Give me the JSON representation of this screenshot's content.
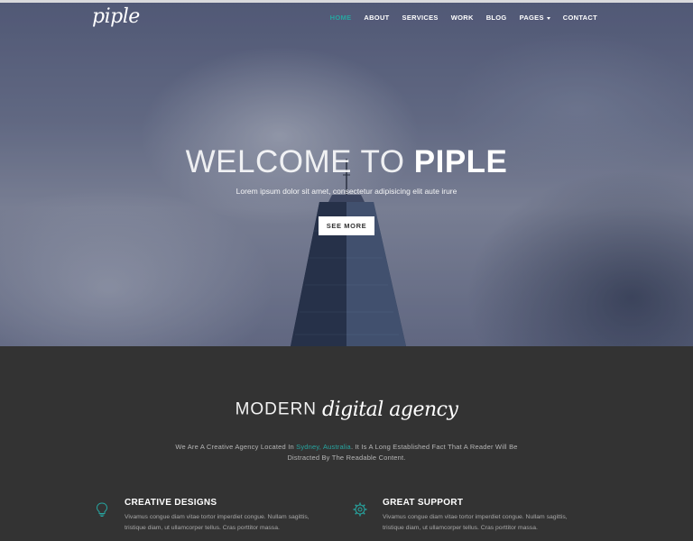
{
  "brand": {
    "logo_text": "piple"
  },
  "nav": {
    "items": [
      {
        "label": "HOME",
        "active": true
      },
      {
        "label": "ABOUT",
        "active": false
      },
      {
        "label": "SERVICES",
        "active": false
      },
      {
        "label": "WORK",
        "active": false
      },
      {
        "label": "BLOG",
        "active": false
      },
      {
        "label": "PAGES",
        "active": false,
        "has_dropdown": true
      },
      {
        "label": "CONTACT",
        "active": false
      }
    ]
  },
  "hero": {
    "title_light": "WELCOME TO ",
    "title_bold": "PIPLE",
    "subtitle": "Lorem ipsum dolor sit amet, consectetur adipisicing elit aute irure",
    "cta_label": "SEE MORE"
  },
  "agency": {
    "title_plain": "MODERN",
    "title_script": "digital agency",
    "desc_before": "We Are A Creative Agency Located In ",
    "desc_highlight": "Sydney, Australia",
    "desc_after": ". It Is A Long Established Fact That A Reader Will Be Distracted By The Readable Content."
  },
  "features": [
    {
      "icon": "lightbulb-icon",
      "title": "CREATIVE DESIGNS",
      "text": "Vivamus congue diam vitae tortor imperdiet congue. Nullam sagittis, tristique diam, ut ullamcorper tellus. Cras porttitor massa."
    },
    {
      "icon": "gear-icon",
      "title": "GREAT SUPPORT",
      "text": "Vivamus congue diam vitae tortor imperdiet congue. Nullam sagittis, tristique diam, ut ullamcorper tellus. Cras porttitor massa."
    }
  ],
  "colors": {
    "accent": "#27a5a0",
    "section_bg": "#333333",
    "hero_tint": "#5a6282"
  }
}
